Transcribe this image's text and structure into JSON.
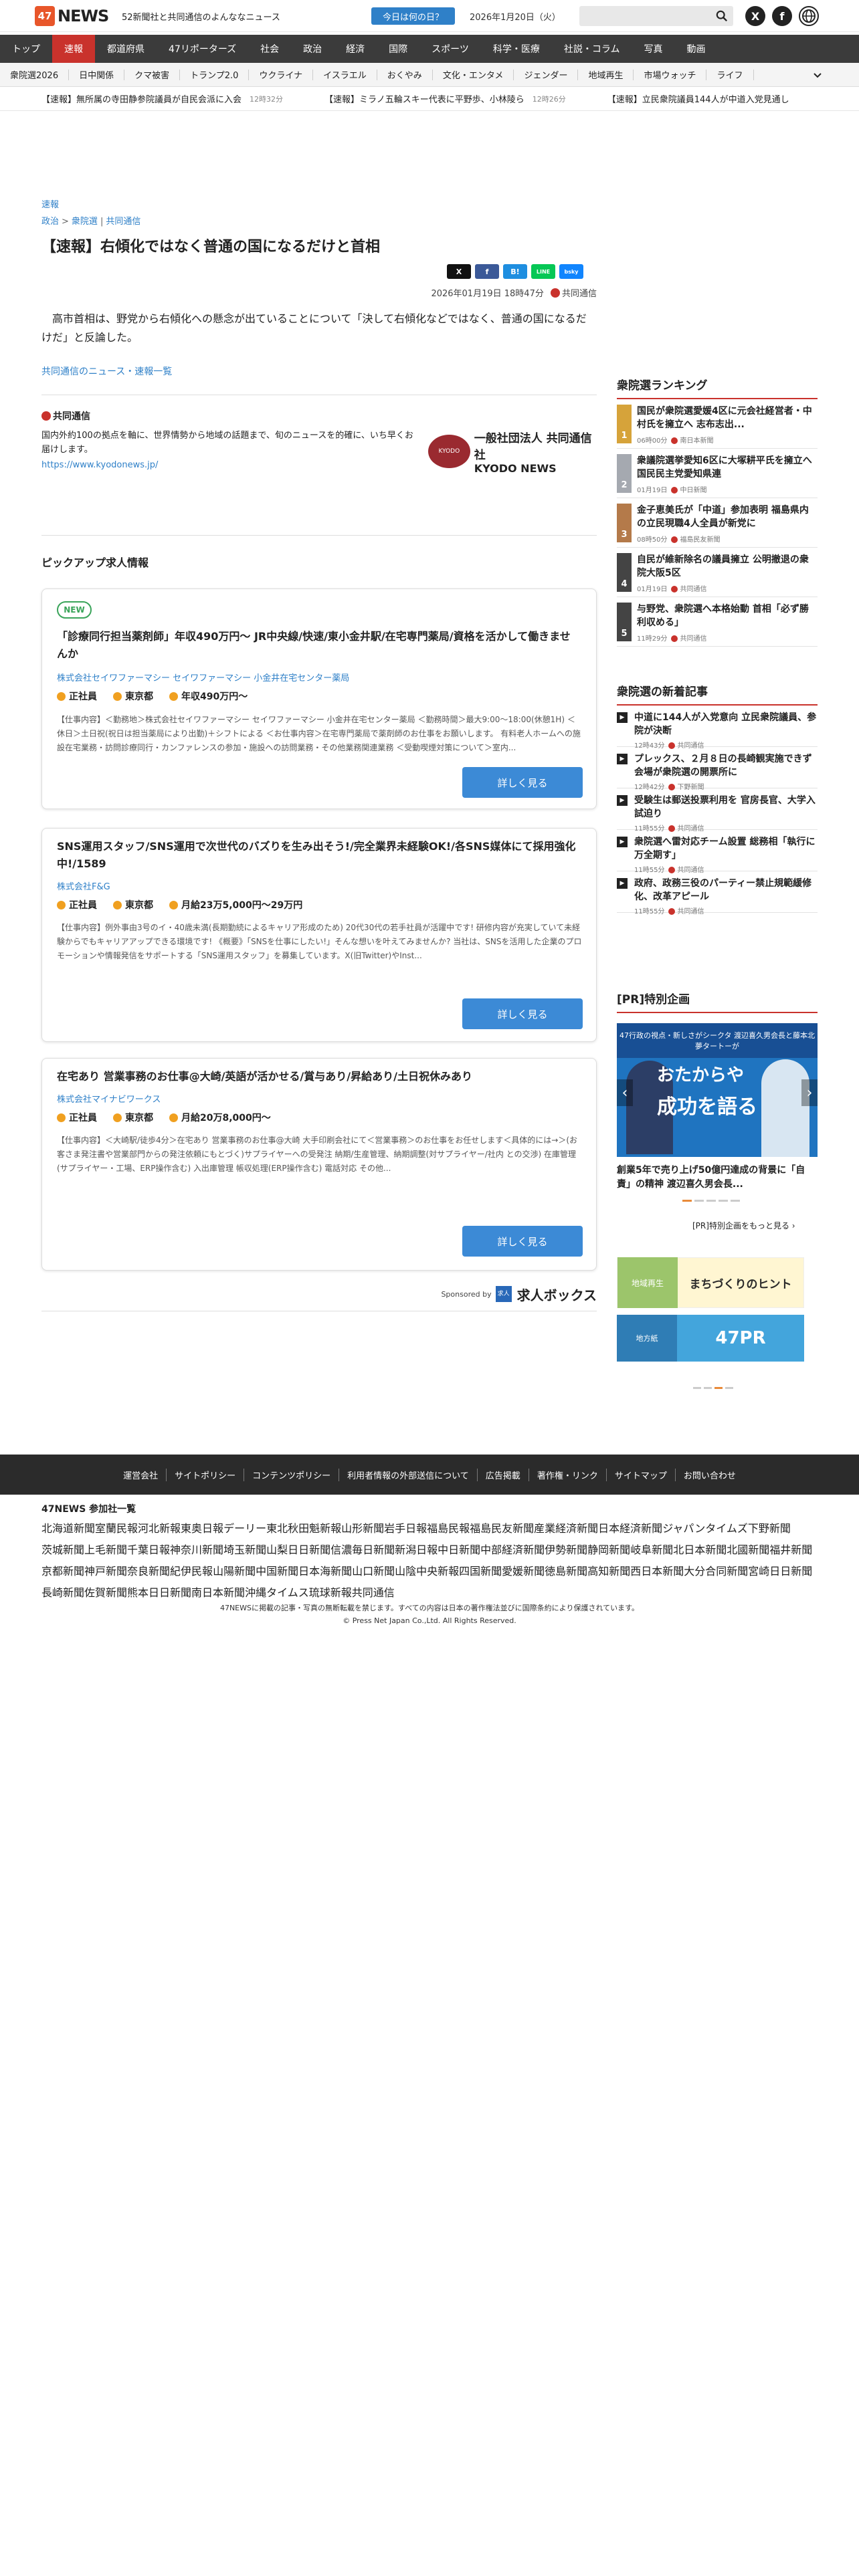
{
  "header": {
    "logo_mark": "47",
    "logo_text": "NEWS",
    "tagline": "52新聞社と共同通信のよんななニュース",
    "today_button": "今日は何の日？",
    "date": "2026年1月20日（火）",
    "search_placeholder": ""
  },
  "nav": {
    "items": [
      "トップ",
      "速報",
      "都道府県",
      "47リポーターズ",
      "社会",
      "政治",
      "経済",
      "国際",
      "スポーツ",
      "科学・医療",
      "社説・コラム",
      "写真",
      "動画"
    ],
    "active": "速報"
  },
  "subnav": {
    "items": [
      "衆院選2026",
      "日中関係",
      "クマ被害",
      "トランプ2.0",
      "ウクライナ",
      "イスラエル",
      "おくやみ",
      "文化・エンタメ",
      "ジェンダー",
      "地域再生",
      "市場ウォッチ",
      "ライフ"
    ]
  },
  "ticker": [
    {
      "text": "【速報】無所属の寺田静参院議員が自民会派に入会",
      "time": "12時32分"
    },
    {
      "text": "【速報】ミラノ五輪スキー代表に平野歩、小林陵ら",
      "time": "12時26分"
    },
    {
      "text": "【速報】立民衆院議員144人が中道入党見通し",
      "time": ""
    }
  ],
  "article": {
    "category": "速報",
    "breadcrumb": [
      "政治",
      "衆院選",
      "共同通信"
    ],
    "title": "【速報】右傾化ではなく普通の国になるだけと首相",
    "datetime": "2026年01月19日 18時47分",
    "source": "共同通信",
    "lead": "高市首相は、野党から右傾化への懸念が出ていることについて「決して右傾化などではなく、普通の国になるだけだ」と反論した。",
    "more_link": "共同通信のニュース・速報一覧",
    "share": [
      "X",
      "f",
      "B!",
      "LINE",
      "bsky"
    ]
  },
  "kyodo": {
    "name": "共同通信",
    "desc": "国内外約100の拠点を軸に、世界情勢から地域の話題まで、旬のニュースを的確に、いち早くお届けします。",
    "url": "https://www.kyodonews.jp/",
    "logo_circle": "KYODO",
    "logo_main": "一般社団法人 共同通信社",
    "logo_en": "KYODO NEWS"
  },
  "pickup": {
    "heading": "ピックアップ求人情報",
    "jobs": [
      {
        "badge": "NEW",
        "title": "「診療同行担当薬剤師」年収490万円～ JR中央線/快速/東小金井駅/在宅専門薬局/資格を活かして働きませんか",
        "company": "株式会社セイワファーマシー セイワファーマシー 小金井在宅センター薬局",
        "type": "正社員",
        "place": "東京都",
        "salary": "年収490万円～",
        "body": "【仕事内容】＜勤務地＞株式会社セイワファーマシー セイワファーマシー 小金井在宅センター薬局 ＜勤務時間＞最大9:00～18:00(休憩1H) ＜休日＞土日祝(祝日は担当薬局により出勤)＋シフトによる ＜お仕事内容＞在宅専門薬局で薬剤師のお仕事をお願いします。 有料老人ホームへの施設在宅業務・訪問診療同行・カンファレンスの参加・施設への訪問業務・その他業務関連業務 ＜受動喫煙対策について＞室内...",
        "button": "詳しく見る"
      },
      {
        "badge": "",
        "title": "SNS運用スタッフ/SNS運用で次世代のバズりを生み出そう!/完全業界未経験OK!/各SNS媒体にて採用強化中!/1589",
        "company": "株式会社F&G",
        "type": "正社員",
        "place": "東京都",
        "salary": "月給23万5,000円～29万円",
        "body": "【仕事内容】例外事由3号のイ・40歳未満(長期勤続によるキャリア形成のため) 20代30代の若手社員が活躍中です! 研修内容が充実していて未経験からでもキャリアアップできる環境です! 《概要》「SNSを仕事にしたい!」そんな想いを叶えてみませんか? 当社は、SNSを活用した企業のプロモーションや情報発信をサポートする「SNS運用スタッフ」を募集しています。X(旧Twitter)やInst...",
        "button": "詳しく見る"
      },
      {
        "badge": "",
        "title": "在宅あり 営業事務のお仕事@大崎/英語が活かせる/賞与あり/昇給あり/土日祝休みあり",
        "company": "株式会社マイナビワークス",
        "type": "正社員",
        "place": "東京都",
        "salary": "月給20万8,000円～",
        "body": "【仕事内容】＜大崎駅/徒歩4分＞在宅あり 営業事務のお仕事@大崎 大手印刷会社にて＜営業事務＞のお仕事をお任せします＜具体的には→＞(お客さま発注書や営業部門からの発注依頼にもとづく)サプライヤーへの受発注 納期/生産管理、納期調整(対サプライヤー/社内 との交渉) 在庫管理(サプライヤー・工場、ERP操作含む) 入出庫管理 帳収処理(ERP操作含む) 電話対応 その他...",
        "button": "詳しく見る"
      }
    ],
    "sponsor_label": "Sponsored by",
    "sponsor_sq": "求人",
    "sponsor_name": "求人ボックス"
  },
  "sidebar": {
    "ranking_title": "衆院選ランキング",
    "ranking": [
      {
        "rank": "1",
        "title": "国民が衆院選愛媛4区に元会社経営者・中村氏を擁立へ 志布志出...",
        "time": "06時00分",
        "source": "南日本新聞",
        "color": "#d6a33a"
      },
      {
        "rank": "2",
        "title": "衆議院選挙愛知6区に大塚耕平氏を擁立へ 国民民主党愛知県連",
        "time": "01月19日",
        "source": "中日新聞",
        "color": "#a5a9b0"
      },
      {
        "rank": "3",
        "title": "金子恵美氏が「中道」参加表明 福島県内の立民現職4人全員が新党に",
        "time": "08時50分",
        "source": "福島民友新聞",
        "color": "#b47a4a"
      },
      {
        "rank": "4",
        "title": "自民が維新除名の議員擁立 公明撤退の衆院大阪5区",
        "time": "01月19日",
        "source": "共同通信",
        "color": "#444444"
      },
      {
        "rank": "5",
        "title": "与野党、衆院選へ本格始動 首相「必ず勝利収める」",
        "time": "11時29分",
        "source": "共同通信",
        "color": "#444444"
      }
    ],
    "new_title": "衆院選の新着記事",
    "new_articles": [
      {
        "title": "中道に144人が入党意向 立民衆院議員、参院が決断",
        "time": "12時43分",
        "source": "共同通信"
      },
      {
        "title": "プレックス、２月８日の長崎観実施できず 会場が衆院選の開票所に",
        "time": "12時42分",
        "source": "下野新聞"
      },
      {
        "title": "受験生は郵送投票利用を 官房長官、大学入試迫り",
        "time": "11時55分",
        "source": "共同通信"
      },
      {
        "title": "衆院選へ雷対応チーム設置 総務相「執行に万全期す」",
        "time": "11時55分",
        "source": "共同通信"
      },
      {
        "title": "政府、政務三役のパーティー禁止規範緩修化、改革アピール",
        "time": "11時55分",
        "source": "共同通信"
      }
    ],
    "pr_title": "[PR]特別企画",
    "pr_banner_top": "47行政の視点・新しさがシークタ\n渡辺喜久男会長と藤本北夢タートーが",
    "pr_banner_big": "おたからや",
    "pr_banner_big2": "成功を語る",
    "pr_caption": "創業5年で売り上げ50億円達成の背景に「自責」の精神 渡辺喜久男会長...",
    "pr_more": "[PR]特別企画をもっと見る",
    "ad1_left": "地域再生",
    "ad1_right": "まちづくりのヒント",
    "ad2_left": "地方紙",
    "ad2_right": "47PR"
  },
  "footer": {
    "links": [
      "運営会社",
      "サイトポリシー",
      "コンテンツポリシー",
      "利用者情報の外部送信について",
      "広告掲載",
      "著作権・リンク",
      "サイトマップ",
      "お問い合わせ"
    ],
    "members_title": "47NEWS 参加社一覧",
    "members": [
      "北海道新聞",
      "室蘭民報",
      "河北新報",
      "東奥日報",
      "デーリー東北",
      "秋田魁新報",
      "山形新聞",
      "岩手日報",
      "福島民報",
      "福島民友新聞",
      "産業経済新聞",
      "日本経済新聞",
      "ジャパンタイムズ",
      "下野新聞",
      "茨城新聞",
      "上毛新聞",
      "千葉日報",
      "神奈川新聞",
      "埼玉新聞",
      "山梨日日新聞",
      "信濃毎日新聞",
      "新潟日報",
      "中日新聞",
      "中部経済新聞",
      "伊勢新聞",
      "静岡新聞",
      "岐阜新聞",
      "北日本新聞",
      "北國新聞",
      "福井新聞",
      "京都新聞",
      "神戸新聞",
      "奈良新聞",
      "紀伊民報",
      "山陽新聞",
      "中国新聞",
      "日本海新聞",
      "山口新聞",
      "山陰中央新報",
      "四国新聞",
      "愛媛新聞",
      "徳島新聞",
      "高知新聞",
      "西日本新聞",
      "大分合同新聞",
      "宮崎日日新聞",
      "長崎新聞",
      "佐賀新聞",
      "熊本日日新聞",
      "南日本新聞",
      "沖縄タイムス",
      "琉球新報",
      "共同通信"
    ],
    "copy1": "47NEWSに掲載の記事・写真の無断転載を禁じます。すべての内容は日本の著作権法並びに国際条約により保護されています。",
    "copy2": "© Press Net Japan Co.,Ltd. All Rights Reserved."
  },
  "colors": {
    "accent_red": "#c9322c",
    "link_blue": "#2f80c8",
    "nav_bg": "#3b3b3b",
    "button_blue": "#3c8ad6"
  }
}
